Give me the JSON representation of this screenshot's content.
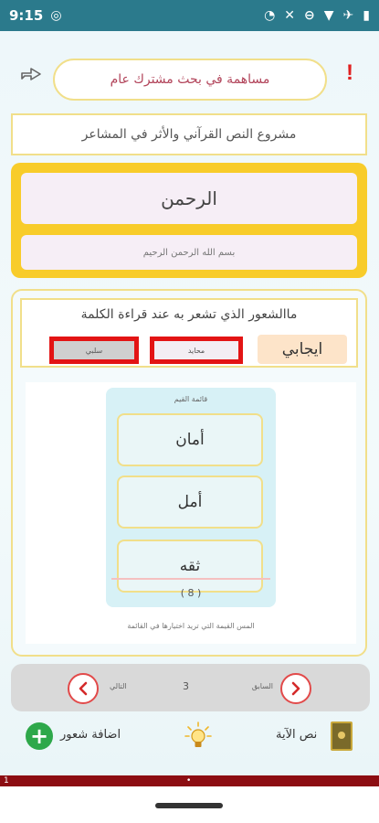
{
  "status_bar": {
    "time": "9:15",
    "icons": [
      "wifi-icon",
      "airplane-icon",
      "battery-icon"
    ]
  },
  "header": {
    "title": "مساهمة في بحث مشترك عام",
    "alert": "!"
  },
  "project": {
    "title": "مشروع النص القرآني والأثر في المشاعر"
  },
  "word_card": {
    "word": "الرحمن",
    "verse": "بسم الله الرحمن الرحيم"
  },
  "feeling": {
    "question": "ماالشعور الذي تشعر به عند قراءة الكلمة",
    "positive": "ايجابي",
    "neutral": "محايد",
    "negative": "سلبي"
  },
  "values": {
    "title": "قائمة القيم",
    "items": [
      "أمان",
      "أمل",
      "ثقه"
    ],
    "count": "( 8 )",
    "hint": "المس القيمة التي تريد اختيارها في القائمة"
  },
  "pager": {
    "next_label": "التالي",
    "prev_label": "السابق",
    "number": "3"
  },
  "bottom": {
    "add_label": "اضافة شعور",
    "verse_label": "نص الآية"
  },
  "ad_bar": {
    "left": "1",
    "center": "•"
  },
  "colors": {
    "status": "#2b7a8c",
    "accent_yellow": "#f8cc2a",
    "alert_red": "#e02020",
    "ad_bar": "#8c0d12"
  }
}
